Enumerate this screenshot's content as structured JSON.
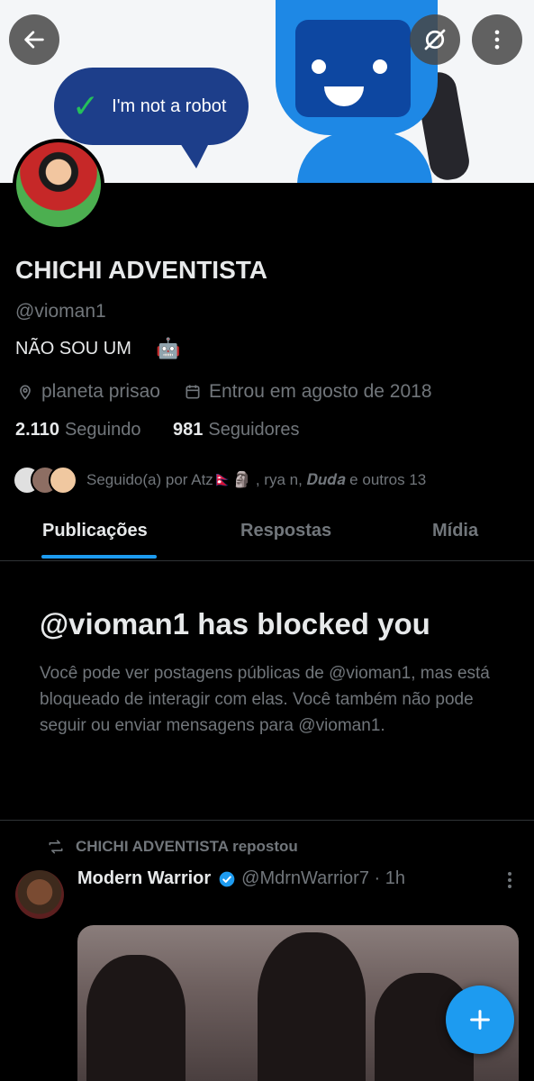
{
  "banner": {
    "bubble_text": "I'm not a robot"
  },
  "profile": {
    "name": "CHICHI ADVENTISTA",
    "handle": "@vioman1",
    "bio": "NÃO SOU UM",
    "bio_emoji": "🤖",
    "location": "planeta prisao",
    "joined": "Entrou em agosto de 2018",
    "following_count": "2.110",
    "following_label": "Seguindo",
    "followers_count": "981",
    "followers_label": "Seguidores",
    "followed_by": "Seguido(a) por Atz🇳🇵🗿 , rya n, 𝑫𝒖𝒅𝒂 e outros 13"
  },
  "tabs": [
    {
      "label": "Publicações",
      "active": true
    },
    {
      "label": "Respostas",
      "active": false
    },
    {
      "label": "Mídia",
      "active": false
    }
  ],
  "blocked": {
    "title": "@vioman1 has blocked you",
    "body": "Você pode ver postagens públicas de @vioman1, mas está bloqueado de interagir com elas. Você também não pode seguir ou enviar mensagens para @vioman1."
  },
  "tweet": {
    "repost_label": "CHICHI ADVENTISTA repostou",
    "author_name": "Modern Warrior",
    "author_handle": "@MdrnWarrior7 · 1h"
  },
  "icons": {
    "back": "arrow-left-icon",
    "secondary": "disconnected-circle-icon",
    "more": "more-vertical-icon",
    "location": "location-pin-icon",
    "calendar": "calendar-icon",
    "repost": "repost-icon",
    "verified": "verified-badge-icon",
    "compose": "plus-icon"
  },
  "colors": {
    "accent": "#1d9bf0",
    "background": "#000000",
    "muted_text": "#71767b",
    "primary_text": "#e7e9ea"
  }
}
